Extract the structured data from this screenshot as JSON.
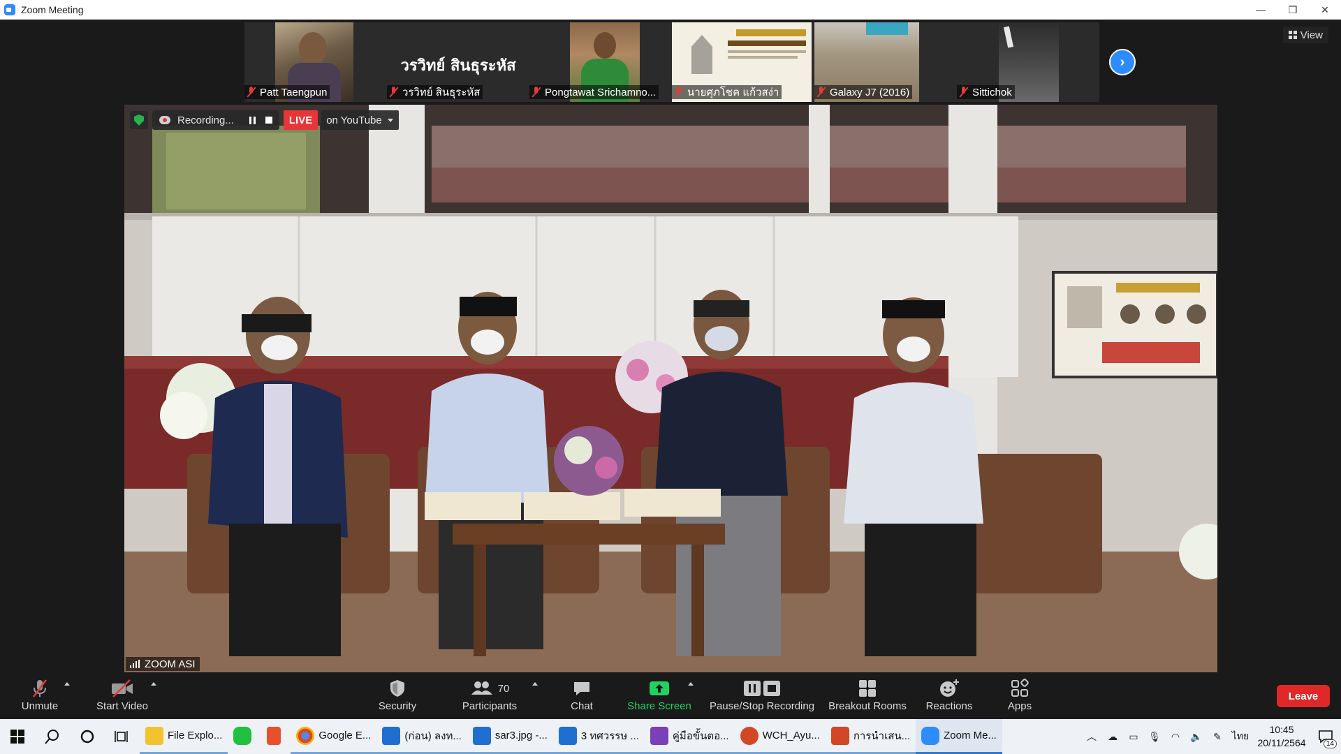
{
  "window": {
    "title": "Zoom Meeting",
    "minimize": "—",
    "restore": "❐",
    "close": "✕"
  },
  "participants_strip": [
    {
      "name": "Patt Taengpun",
      "muted": true
    },
    {
      "name": "วรวิทย์  สินธุระหัส",
      "display_text": "วรวิทย์  สินธุระหัส",
      "muted": true
    },
    {
      "name": "Pongtawat Srichamno...",
      "muted": true
    },
    {
      "name": "นายศุภโชค แก้วสง่า",
      "muted": true
    },
    {
      "name": "Galaxy J7 (2016)",
      "muted": true
    },
    {
      "name": "Sittichok",
      "muted": true
    }
  ],
  "view_button": "View",
  "recording": {
    "status": "Recording...",
    "live": "LIVE",
    "destination": "on YouTube"
  },
  "main_video_label": "ZOOM ASI",
  "toolbar": {
    "unmute": "Unmute",
    "start_video": "Start Video",
    "security": "Security",
    "participants": "Participants",
    "participants_count": "70",
    "chat": "Chat",
    "share_screen": "Share Screen",
    "pause_stop_recording": "Pause/Stop Recording",
    "breakout_rooms": "Breakout Rooms",
    "reactions": "Reactions",
    "apps": "Apps",
    "leave": "Leave"
  },
  "taskbar": {
    "apps": [
      {
        "label": "File Explo...",
        "color": "#f2c230"
      },
      {
        "label": "",
        "color": "#20c040",
        "name": "line"
      },
      {
        "label": "",
        "color": "#e8502d",
        "name": "office"
      },
      {
        "label": "Google E...",
        "color": "#db4437"
      },
      {
        "label": "(ก่อน) ลงท...",
        "color": "#1e6fd0"
      },
      {
        "label": "sar3.jpg -...",
        "color": "#1e6fd0"
      },
      {
        "label": "3 ทศวรรษ ...",
        "color": "#1e6fd0"
      },
      {
        "label": "คู่มือขั้นตอ...",
        "color": "#7b3fb8"
      },
      {
        "label": "WCH_Ayu...",
        "color": "#d24726"
      },
      {
        "label": "การนำเสน...",
        "color": "#d24726"
      },
      {
        "label": "Zoom Me...",
        "color": "#2d8cff"
      }
    ],
    "language": "ไทย",
    "time": "10:45",
    "date": "20/11/2564",
    "notifications": "14"
  }
}
